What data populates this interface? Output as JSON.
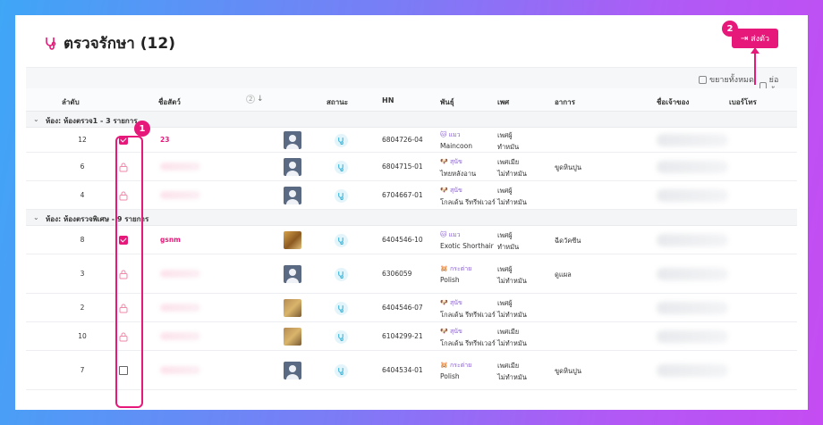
{
  "page": {
    "title": "ตรวจรักษา (12)",
    "send_button": "ส่งตัว"
  },
  "toolbar": {
    "expand_all": "ขยายทั้งหมด",
    "collapse_all": "ย่อทั้งหมด"
  },
  "columns": {
    "order": "ลำดับ",
    "pet_name": "ชื่อสัตว์",
    "sort_badge": "2",
    "status": "สถานะ",
    "hn": "HN",
    "species": "พันธุ์",
    "sex": "เพศ",
    "symptom": "อาการ",
    "owner": "ชื่อเจ้าของ",
    "phone": "เบอร์โทร"
  },
  "groups": [
    {
      "label": "ห้อง: ห้องตรวจ1 - 3 รายการ",
      "rows": [
        {
          "order": "12",
          "select": "checked",
          "name": "23",
          "avatar": "default",
          "hn": "6804726-04",
          "species_top": "🐱 แมว",
          "species": "Maincoon",
          "sex_top": "เพศผู้",
          "sex": "ทำหมัน",
          "symptom": ""
        },
        {
          "order": "6",
          "select": "locked",
          "name": "",
          "avatar": "default",
          "hn": "6804715-01",
          "species_top": "🐶 สุนัข",
          "species": "ไทยหลังอาน",
          "sex_top": "เพศเมีย",
          "sex": "ไม่ทำหมัน",
          "symptom": "ขูดหินปูน"
        },
        {
          "order": "4",
          "select": "locked",
          "name": "",
          "avatar": "default",
          "hn": "6704667-01",
          "species_top": "🐶 สุนัข",
          "species": "โกลเด้น รีทรีฟเวอร์",
          "sex_top": "เพศผู้",
          "sex": "ไม่ทำหมัน",
          "symptom": ""
        }
      ]
    },
    {
      "label": "ห้อง: ห้องตรวจพิเศษ - 9 รายการ",
      "rows": [
        {
          "order": "8",
          "select": "checked",
          "name": "gsnm",
          "avatar": "photo",
          "hn": "6404546-10",
          "species_top": "🐱 แมว",
          "species": "Exotic Shorthair",
          "sex_top": "เพศผู้",
          "sex": "ทำหมัน",
          "symptom": "ฉีดวัคซีน"
        },
        {
          "order": "3",
          "select": "locked",
          "name": "",
          "avatar": "default",
          "hn": "6306059",
          "species_top": "🐹 กระต่าย",
          "species": "Polish",
          "sex_top": "เพศผู้",
          "sex": "ไม่ทำหมัน",
          "symptom": "ดูแผล"
        },
        {
          "order": "2",
          "select": "locked",
          "name": "",
          "avatar": "photo2",
          "hn": "6404546-07",
          "species_top": "🐶 สุนัข",
          "species": "โกลเด้น รีทรีฟเวอร์",
          "sex_top": "เพศผู้",
          "sex": "ไม่ทำหมัน",
          "symptom": ""
        },
        {
          "order": "10",
          "select": "locked",
          "name": "",
          "avatar": "photo2",
          "hn": "6104299-21",
          "species_top": "🐶 สุนัข",
          "species": "โกลเด้น รีทรีฟเวอร์",
          "sex_top": "เพศเมีย",
          "sex": "ไม่ทำหมัน",
          "symptom": ""
        },
        {
          "order": "7",
          "select": "empty",
          "name": "",
          "avatar": "default",
          "hn": "6404534-01",
          "species_top": "🐹 กระต่าย",
          "species": "Polish",
          "sex_top": "เพศเมีย",
          "sex": "ไม่ทำหมัน",
          "symptom": "ขูดหินปูน"
        }
      ]
    }
  ],
  "annotations": {
    "badge1": "1",
    "badge2": "2"
  },
  "colors": {
    "accent": "#e6197a",
    "status_bg": "#e3f5fb",
    "status_icon": "#3bb6d8"
  },
  "icons": {
    "title": "stethoscope-icon",
    "locked": "lock-icon",
    "status": "stethoscope-icon",
    "send": "arrow-right-icon"
  }
}
